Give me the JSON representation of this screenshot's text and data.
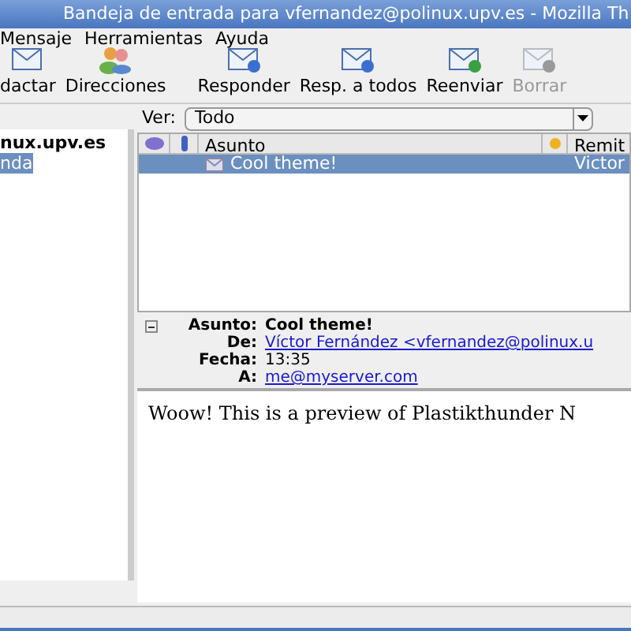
{
  "window": {
    "title": "Bandeja de entrada para vfernandez@polinux.upv.es - Mozilla Th"
  },
  "menu": [
    "Mensaje",
    "Herramientas",
    "Ayuda"
  ],
  "toolbar": [
    {
      "label": "dactar",
      "kind": "compose",
      "disabled": false
    },
    {
      "label": "Direcciones",
      "kind": "contacts",
      "disabled": false
    },
    {
      "label": "Responder",
      "kind": "reply",
      "disabled": false
    },
    {
      "label": "Resp. a todos",
      "kind": "replyall",
      "disabled": false
    },
    {
      "label": "Reenviar",
      "kind": "forward",
      "disabled": false
    },
    {
      "label": "Borrar",
      "kind": "delete",
      "disabled": true
    }
  ],
  "folders": [
    {
      "label": "nux.upv.es",
      "kind": "account",
      "selected": false
    },
    {
      "label": "nda",
      "kind": "folder",
      "selected": true
    }
  ],
  "view": {
    "label": "Ver:",
    "value": "Todo"
  },
  "message_list": {
    "columns": [
      "Asunto",
      "Remit"
    ],
    "rows": [
      {
        "subject": "Cool theme!",
        "sender": "Victor",
        "selected": true
      }
    ]
  },
  "header": {
    "fields": [
      {
        "label": "Asunto:",
        "value": "Cool theme!",
        "kind": "bold"
      },
      {
        "label": "De:",
        "value": "Víctor Fernández <vfernandez@polinux.u",
        "kind": "link"
      },
      {
        "label": "Fecha:",
        "value": "13:35",
        "kind": "plain"
      },
      {
        "label": "A:",
        "value": "me@myserver.com",
        "kind": "link"
      }
    ]
  },
  "body": "Woow! This is a preview of Plastikthunder N"
}
